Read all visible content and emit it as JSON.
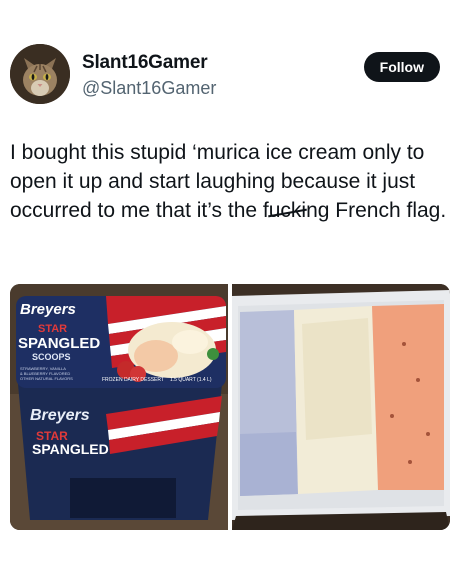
{
  "author": {
    "display_name": "Slant16Gamer",
    "handle": "@Slant16Gamer",
    "avatar_icon": "cat-avatar-icon"
  },
  "actions": {
    "follow_label": "Follow"
  },
  "tweet": {
    "text_before": "I bought this stupid ‘murica ice cream only to open it up and start laughing because it just occurred to me that it’s the f",
    "text_crossed": "ucki",
    "text_after": "ng French flag."
  },
  "media": {
    "left_photo": {
      "brand": "Breyers",
      "brand_lid_side": "Breyers",
      "label_star": "STAR",
      "label_spangled": "SPANGLED",
      "label_scoops": "SCOOPS",
      "label_fine_print": [
        "STRAWBERRY, VANILLA",
        "& BLUEBERRY FLAVORED",
        "OTHER NATURAL FLAVORS"
      ],
      "label_dessert": "FROZEN DAIRY DESSERT",
      "label_size": "1.5 QUART (1.4 L)",
      "side_star": "STAR",
      "side_spangled": "SPANGLED"
    },
    "right_photo": {
      "subject": "blue-white-red-ice-cream-icon"
    }
  },
  "colors": {
    "text": "#0f1419",
    "secondary_text": "#536471",
    "follow_bg": "#0f1419",
    "ice_blue": "#b8bfd9",
    "ice_white": "#f2ecd7",
    "ice_red": "#f0a07c"
  }
}
